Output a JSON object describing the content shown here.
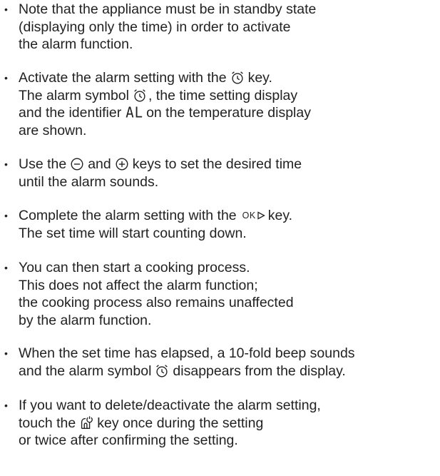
{
  "items": [
    {
      "lines": [
        "Note that the appliance must be in standby state",
        "(displaying only the time) in order to activate",
        "the alarm function."
      ]
    },
    {
      "line1_before": "Activate the alarm setting with the",
      "line1_after": "key.",
      "line2_before": "The alarm symbol",
      "line2_after": ", the time setting display",
      "line3_before": "and the identifier",
      "line3_code": "AL",
      "line3_after": "on the temperature display",
      "line4": "are shown."
    },
    {
      "line1_before": "Use the",
      "line1_mid": "and",
      "line1_after": "keys to set the desired time",
      "line2": "until the alarm sounds."
    },
    {
      "line1_before": "Complete the alarm setting with the",
      "ok_label": "OK",
      "line1_after": "key.",
      "line2": "The set time will start counting down."
    },
    {
      "lines": [
        "You can then start a cooking process.",
        "This does not affect the alarm function;",
        "the cooking process also remains unaffected",
        "by the alarm function."
      ]
    },
    {
      "line1": "When the set time has elapsed, a 10-fold beep sounds",
      "line2_before": "and the alarm symbol",
      "line2_after": "disappears from the display."
    },
    {
      "line1": "If you want to delete/deactivate the alarm setting,",
      "line2_before": "touch the",
      "line2_after": "key once during the setting",
      "line3": "or twice after confirming the setting."
    }
  ],
  "bullet": "•",
  "icons": {
    "alarm": "alarm-clock-icon",
    "minus": "minus-circle-icon",
    "plus": "plus-circle-icon",
    "ok_arrow": "play-triangle-icon",
    "power": "power-key-icon"
  }
}
